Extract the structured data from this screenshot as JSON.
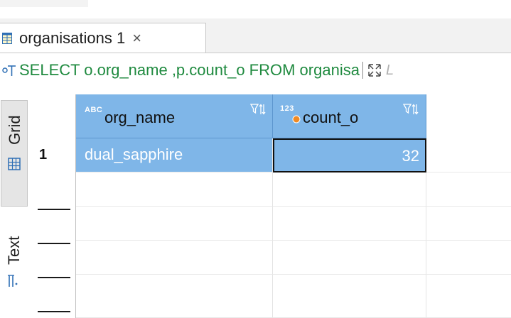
{
  "tab": {
    "label": "organisations 1",
    "close_glyph": "×",
    "icon": "table-grid-icon"
  },
  "query": {
    "sql": "SELECT o.org_name ,p.count_o FROM organisa",
    "icon": "sql-query-icon",
    "maximize_icon": "maximize-arrows-icon",
    "overflow_glyph": "L"
  },
  "side_tabs": {
    "grid": {
      "label": "Grid",
      "icon": "grid-icon"
    },
    "text": {
      "label": "Text",
      "icon": "text-mode-icon"
    }
  },
  "columns": [
    {
      "name": "org_name",
      "type_badge": "ABC",
      "type": "string"
    },
    {
      "name": "count_o",
      "type_badge": "123",
      "type": "number"
    }
  ],
  "rows": [
    {
      "row_number": "1",
      "org_name": "dual_sapphire",
      "count_o": "32"
    }
  ],
  "colors": {
    "header_bg": "#7fb6e8",
    "selection_bg": "#7fb6e8",
    "sql_text": "#1f8a3f",
    "badge_orange": "#f08a24"
  }
}
